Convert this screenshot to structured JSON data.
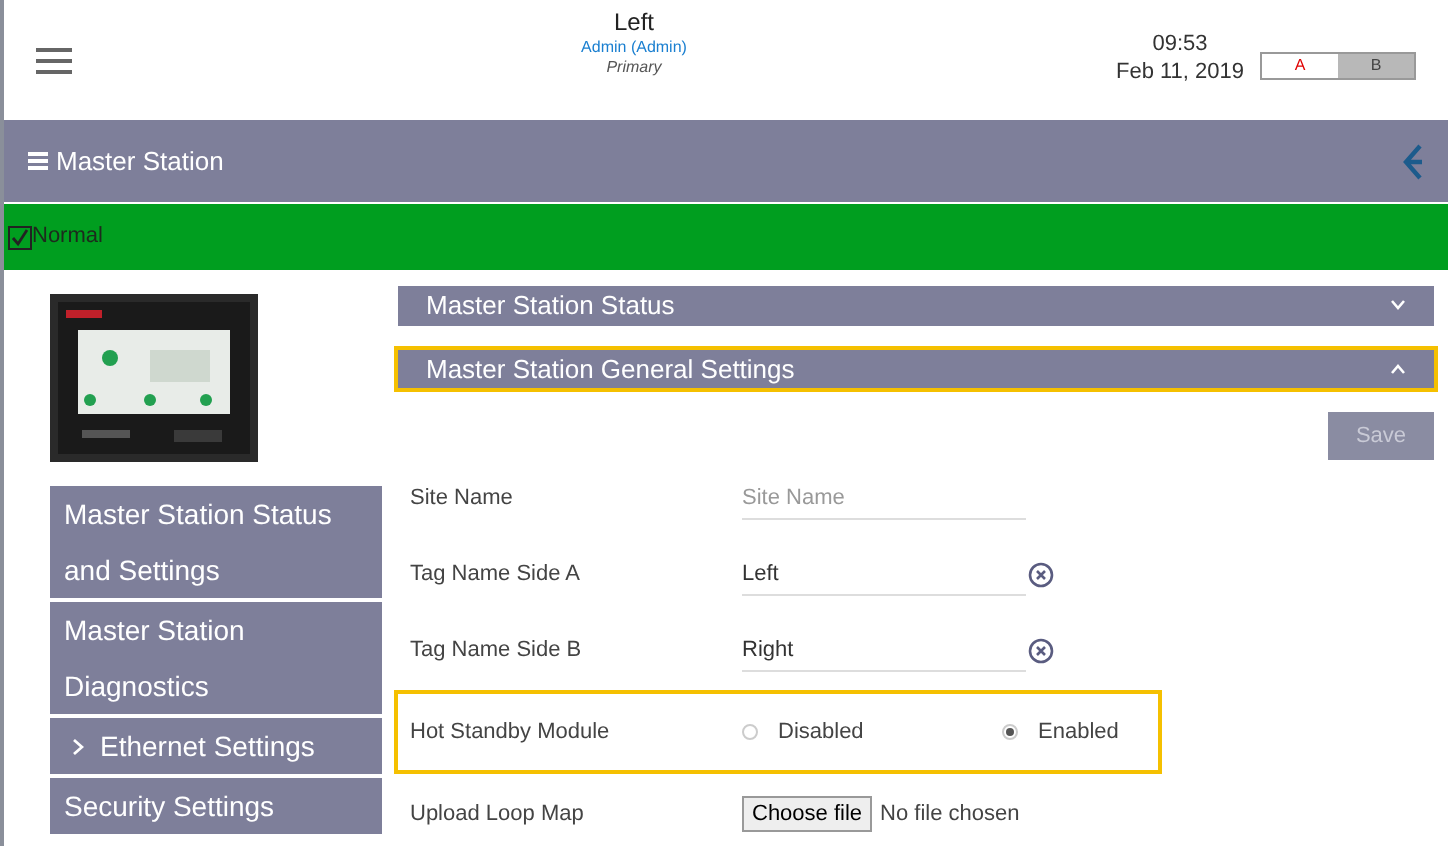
{
  "header": {
    "title": "Left",
    "user": "Admin (Admin)",
    "role": "Primary",
    "time": "09:53",
    "date": "Feb 11, 2019",
    "sides": [
      {
        "label": "A",
        "selected": true
      },
      {
        "label": "B",
        "selected": false
      }
    ]
  },
  "title_bar": {
    "title": "Master Station"
  },
  "status_bar": {
    "label": "Normal",
    "checked": true
  },
  "sidebar": {
    "items": [
      {
        "label": "Master Station Status and Settings",
        "expandable": false
      },
      {
        "label": "Master Station Diagnostics",
        "expandable": false
      },
      {
        "label": "Ethernet Settings",
        "expandable": true
      },
      {
        "label": "Security Settings",
        "expandable": false
      }
    ]
  },
  "sections": [
    {
      "title": "Master Station Status",
      "expanded": false,
      "highlighted": false
    },
    {
      "title": "Master Station General Settings",
      "expanded": true,
      "highlighted": true
    }
  ],
  "save_button": "Save",
  "form": [
    {
      "kind": "text",
      "label": "Site Name",
      "placeholder": "Site Name",
      "clearable": false,
      "highlighted": false
    },
    {
      "kind": "text",
      "label": "Tag Name Side A",
      "value": "Left",
      "clearable": true,
      "highlighted": false
    },
    {
      "kind": "text",
      "label": "Tag Name Side B",
      "value": "Right",
      "clearable": true,
      "highlighted": false
    },
    {
      "kind": "radio",
      "label": "Hot Standby Module",
      "highlighted": true,
      "options": [
        {
          "label": "Disabled",
          "selected": false
        },
        {
          "label": "Enabled",
          "selected": true
        }
      ]
    },
    {
      "kind": "file",
      "label": "Upload Loop Map",
      "button": "Choose file",
      "status": "No file chosen",
      "highlighted": false
    }
  ]
}
